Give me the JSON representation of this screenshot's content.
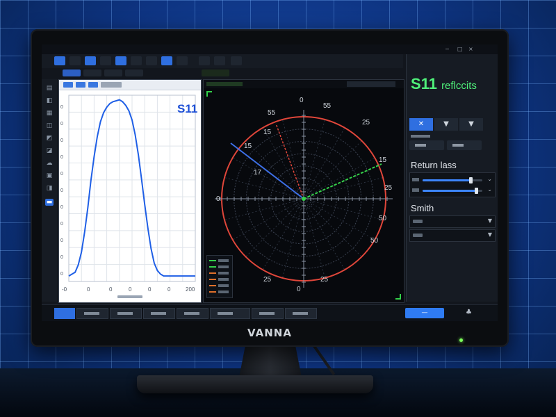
{
  "monitor": {
    "brand": "VANNA"
  },
  "window": {
    "controls": [
      "−",
      "□",
      "×"
    ]
  },
  "plot": {
    "title": "S11",
    "x_ticks": [
      "-0",
      "0",
      "0",
      "0",
      "0",
      "0",
      "200"
    ],
    "y_ticks": [
      "0",
      "0",
      "0",
      "0",
      "0",
      "0",
      "0",
      "0",
      "0",
      "0",
      "0"
    ]
  },
  "chart_data": {
    "type": "line",
    "title": "S11",
    "xlabel": "",
    "ylabel": "",
    "series": [
      {
        "color": "#1f5fe6",
        "x": [
          0,
          5,
          10,
          15,
          20,
          25,
          30,
          35,
          40,
          45,
          50,
          55,
          60,
          65,
          70,
          75,
          80,
          85,
          90,
          95,
          100,
          105,
          110,
          115,
          120,
          125,
          130,
          135,
          140,
          145,
          150,
          155,
          160,
          165,
          170,
          175,
          180,
          185,
          190,
          195,
          200
        ],
        "y": [
          0.03,
          0.04,
          0.05,
          0.09,
          0.16,
          0.27,
          0.4,
          0.55,
          0.68,
          0.79,
          0.87,
          0.92,
          0.95,
          0.97,
          0.98,
          0.985,
          0.99,
          0.98,
          0.96,
          0.93,
          0.88,
          0.8,
          0.69,
          0.56,
          0.42,
          0.29,
          0.18,
          0.1,
          0.06,
          0.04,
          0.03,
          0.03,
          0.03,
          0.03,
          0.03,
          0.03,
          0.03,
          0.03,
          0.03,
          0.03,
          0.03
        ]
      }
    ],
    "grid": true
  },
  "smith": {
    "labels": {
      "top": "0",
      "top_right_a": "55",
      "top_right_b": "25",
      "right_a": "15",
      "right_b": "25",
      "right_c": "50",
      "left_a": "55",
      "left_b": "15",
      "left_c": "17",
      "left_d": "0",
      "bottom": "0",
      "bottom_left": "25",
      "bottom_right": "25",
      "bottom_right_b": "50",
      "left_e": "15"
    },
    "legend_colors": [
      "#35d14a",
      "#35d14a",
      "#e0702a",
      "#e0702a",
      "#e0702a",
      "#e0702a"
    ]
  },
  "right_panel": {
    "title": "S11",
    "title_sub": "reflccits",
    "section_return_loss": "Return lass",
    "section_smith": "Smith",
    "slider1": 0.8,
    "slider2": 0.9
  },
  "bottom": {
    "apply_glyph": "—",
    "icon_glyph": "♣"
  },
  "colors": {
    "accent": "#2f6fe0",
    "title_green": "#4ff07a",
    "smith_circle": "#e0463a",
    "trace_blue": "#1f5fe6"
  }
}
